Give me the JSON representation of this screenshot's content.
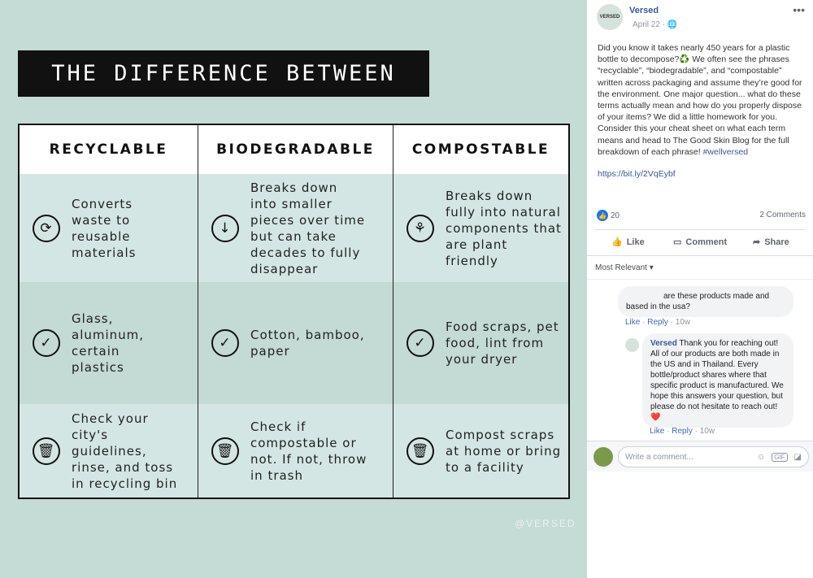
{
  "image": {
    "title": "THE DIFFERENCE BETWEEN",
    "columns": [
      "RECYCLABLE",
      "BIODEGRADABLE",
      "COMPOSTABLE"
    ],
    "rows": [
      {
        "icon": "recycle-arrows-icon",
        "cells": [
          "Converts waste to reusable materials",
          "Breaks down into smaller pieces over time but can take decades to fully disappear",
          "Breaks down fully into natural components that are plant friendly"
        ],
        "icons": [
          "recycle-arrows-icon",
          "soil-arrow-icon",
          "sprout-icon"
        ]
      },
      {
        "icon": "checkmark-icon",
        "cells": [
          "Glass, aluminum, certain plastics",
          "Cotton, bamboo, paper",
          "Food scraps, pet food, lint from your dryer"
        ]
      },
      {
        "icon": "trash-can-icon",
        "cells": [
          "Check your city's guidelines, rinse, and toss in recycling bin",
          "Check if compostable or not. If not, throw in trash",
          "Compost scraps at home or bring to a facility"
        ]
      }
    ],
    "watermark": "@VERSED"
  },
  "post": {
    "page_name": "Versed",
    "avatar_text": "VERSED",
    "date": "April 22",
    "globe": "globe-icon",
    "text": "Did you know it takes nearly 450 years for a plastic bottle to decompose?♻️ We often see the phrases “recyclable”, “biodegradable”, and “compostable” written across packaging and assume they’re good for the environment. One major question... what do these terms actually mean and how do you properly dispose of your items? We did a little homework for you. Consider this your cheat sheet on what each term means and head to The Good Skin Blog for the full breakdown of each phrase! ",
    "hashtag": "#wellversed",
    "link": "https://bit.ly/2VqEybf",
    "likes": "20",
    "comments_count": "2 Comments",
    "actions": {
      "like": "Like",
      "comment": "Comment",
      "share": "Share"
    },
    "sort": "Most Relevant"
  },
  "comments": [
    {
      "text": "are these products made and based in the usa?",
      "like": "Like",
      "reply": "Reply",
      "time": "10w"
    },
    {
      "author": "Versed",
      "text": "Thank you for reaching out! All of our products are both made in the US and in Thailand. Every bottle/product shares where that specific product is manufactured. We hope this answers your question, but please do not hesitate to reach out!",
      "emoji": "❤️",
      "like": "Like",
      "reply": "Reply",
      "time": "10w"
    }
  ],
  "composer": {
    "placeholder": "Write a comment..."
  },
  "colors": {
    "image_bg": "#c5dbd6",
    "row_light": "#d4e6e3",
    "row_dark": "#c3dad5",
    "fb_blue": "#385898"
  }
}
